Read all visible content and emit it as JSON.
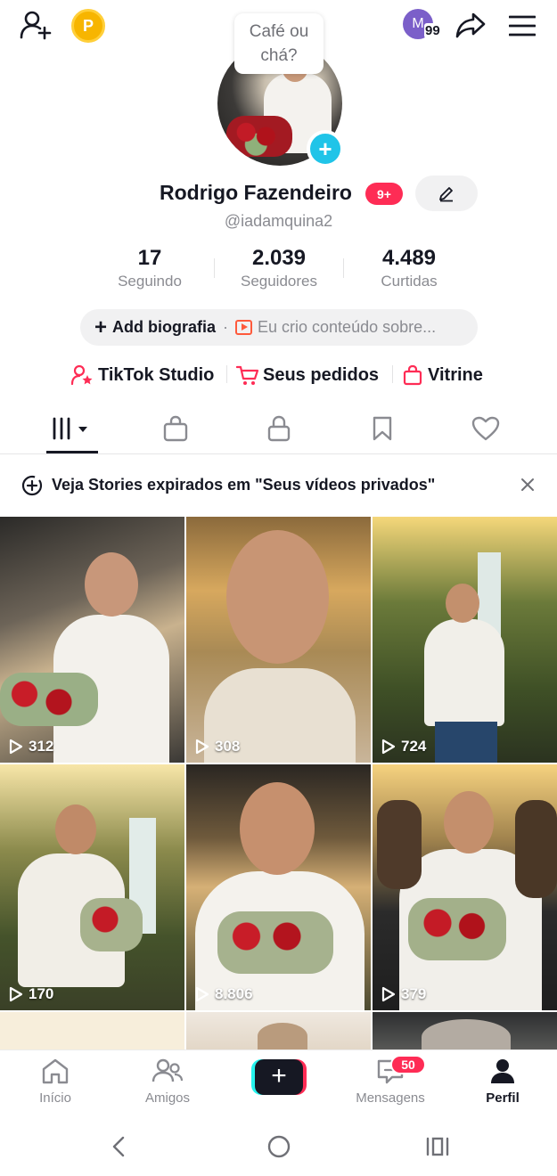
{
  "bubble": {
    "line1": "Café ou",
    "line2": "chá?"
  },
  "header": {
    "badge_letter": "M",
    "badge_count": "99",
    "points_letter": "P"
  },
  "profile": {
    "name": "Rodrigo Fazendeiro",
    "notif_badge": "9+",
    "handle": "@iadamquina2"
  },
  "stats": [
    {
      "value": "17",
      "label": "Seguindo"
    },
    {
      "value": "2.039",
      "label": "Seguidores"
    },
    {
      "value": "4.489",
      "label": "Curtidas"
    }
  ],
  "bio": {
    "plus": "+",
    "add_label": "Add biografia",
    "separator": "·",
    "placeholder": "Eu crio conteúdo sobre..."
  },
  "quick_links": [
    {
      "label": "TikTok Studio",
      "icon": "person-star-icon"
    },
    {
      "label": "Seus pedidos",
      "icon": "cart-icon"
    },
    {
      "label": "Vitrine",
      "icon": "shopping-bag-icon"
    }
  ],
  "tabs": [
    {
      "name": "videos",
      "icon": "grid-bars-icon",
      "active": true
    },
    {
      "name": "shop",
      "icon": "shopping-bag-icon"
    },
    {
      "name": "private",
      "icon": "lock-icon"
    },
    {
      "name": "saved",
      "icon": "bookmark-icon"
    },
    {
      "name": "liked",
      "icon": "heart-icon"
    }
  ],
  "banner": {
    "text": "Veja Stories expirados em \"Seus vídeos privados\""
  },
  "videos": [
    {
      "views": "312"
    },
    {
      "views": "308"
    },
    {
      "views": "724"
    },
    {
      "views": "170"
    },
    {
      "views": "8.806"
    },
    {
      "views": "379"
    }
  ],
  "bottom_nav": {
    "home": "Início",
    "friends": "Amigos",
    "create": "+",
    "messages": "Mensagens",
    "messages_badge": "50",
    "profile": "Perfil"
  },
  "colors": {
    "accent": "#fe2c55",
    "cyan": "#25f4ee",
    "text": "#161823",
    "muted": "#8a8b91"
  }
}
